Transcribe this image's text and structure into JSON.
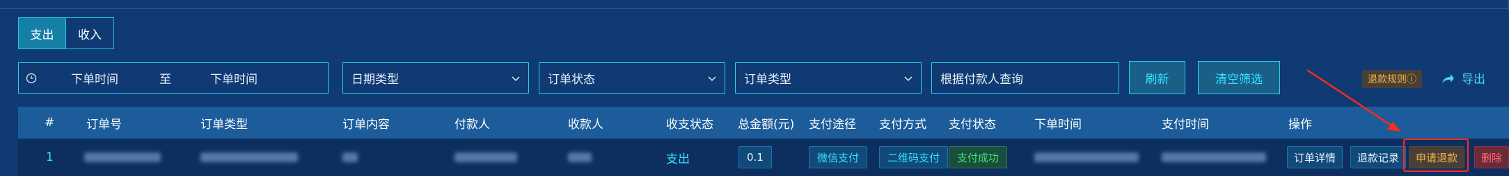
{
  "tabs": {
    "expense": "支出",
    "income": "收入",
    "active": "expense"
  },
  "filters": {
    "date_start_placeholder": "下单时间",
    "date_to": "至",
    "date_end_placeholder": "下单时间",
    "date_type": "日期类型",
    "order_status": "订单状态",
    "order_type": "订单类型",
    "search_placeholder": "根据付款人查询",
    "refresh_label": "刷新",
    "clear_label": "清空筛选"
  },
  "toolbar": {
    "refund_rules": "退款规则ⓘ",
    "export_label": "导出"
  },
  "table": {
    "headers": [
      "#",
      "订单号",
      "订单类型",
      "订单内容",
      "付款人",
      "收款人",
      "收支状态",
      "总金额(元)",
      "支付途径",
      "支付方式",
      "支付状态",
      "下单时间",
      "支付时间",
      "操作"
    ],
    "rows": [
      {
        "index": "1",
        "direction": "支出",
        "amount": "0.1",
        "pay_channel": "微信支付",
        "pay_method": "二维码支付",
        "pay_status": "支付成功",
        "actions": {
          "detail": "订单详情",
          "refund_record": "退款记录",
          "apply_refund": "申请退款",
          "delete": "删除"
        }
      }
    ]
  },
  "colors": {
    "background": "#0f3a73",
    "accent": "#2ad2f0",
    "highlight": "#ff2a1a",
    "success": "#3ee27a",
    "warning": "#f2b44c"
  }
}
